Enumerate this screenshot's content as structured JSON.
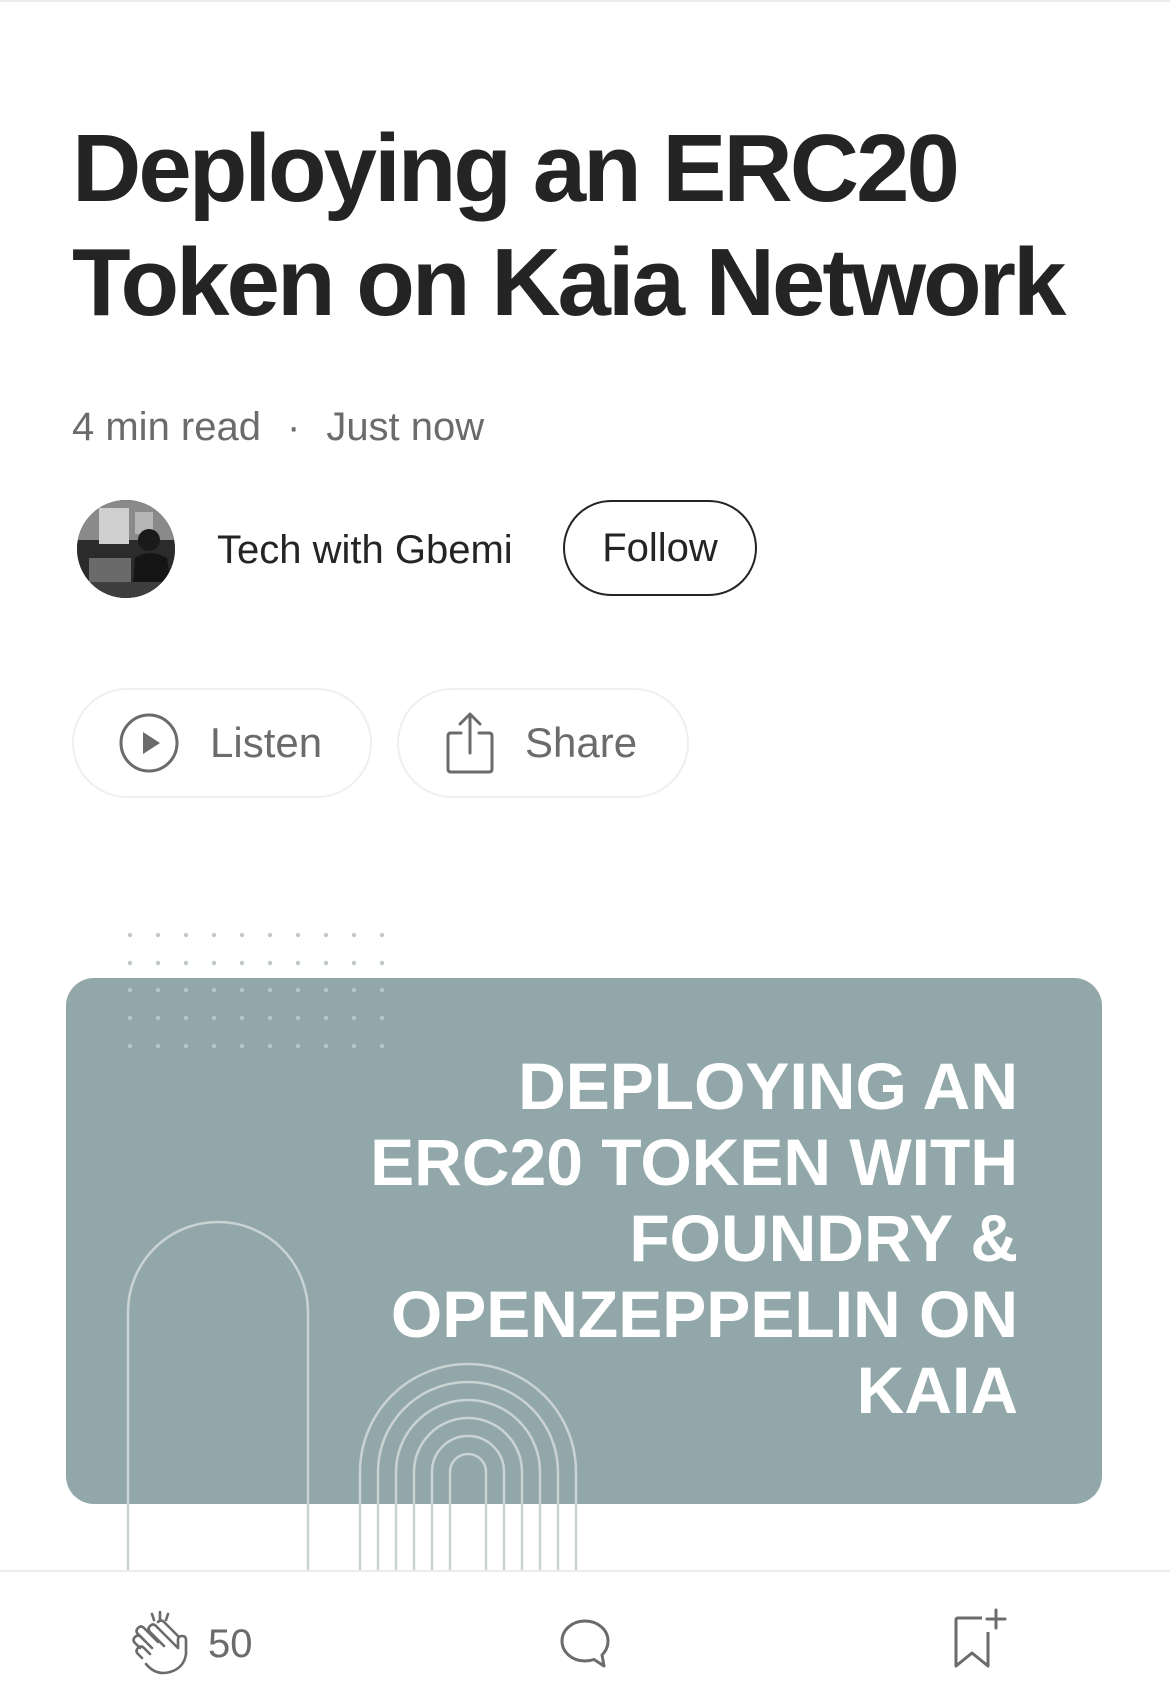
{
  "article": {
    "title": "Deploying an ERC20 Token on Kaia Network",
    "read_time": "4 min read",
    "separator": "·",
    "published": "Just now"
  },
  "author": {
    "name": "Tech with Gbemi",
    "follow_label": "Follow"
  },
  "actions": {
    "listen_label": "Listen",
    "share_label": "Share"
  },
  "hero_image": {
    "lines": [
      "DEPLOYING AN",
      "ERC20 TOKEN WITH",
      "FOUNDRY &",
      "OPENZEPPELIN ON",
      "KAIA"
    ],
    "background_color": "#92a7aa",
    "text_color": "#ffffff"
  },
  "bottom_bar": {
    "clap_count": "50",
    "icons": [
      "clap-icon",
      "comment-icon",
      "bookmark-add-icon"
    ]
  },
  "colors": {
    "text_primary": "#242424",
    "text_secondary": "#6b6b6b",
    "border": "#efefef"
  }
}
